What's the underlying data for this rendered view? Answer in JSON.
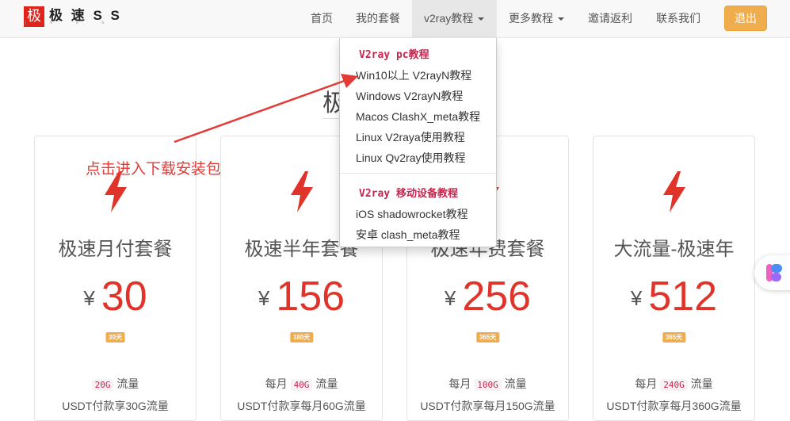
{
  "brand": {
    "logo_char": "极",
    "name": "极 速 S S",
    "subtitle": "j s s s"
  },
  "nav": {
    "items": [
      {
        "label": "首页"
      },
      {
        "label": "我的套餐"
      },
      {
        "label": "v2ray教程"
      },
      {
        "label": "更多教程"
      },
      {
        "label": "邀请返利"
      },
      {
        "label": "联系我们"
      }
    ],
    "logout": "退出"
  },
  "page": {
    "title": "极"
  },
  "dropdown": {
    "pc_header": "V2ray pc教程",
    "pc_items": [
      "Win10以上 V2rayN教程",
      "Windows V2rayN教程",
      "Macos ClashX_meta教程",
      "Linux V2raya使用教程",
      "Linux Qv2ray使用教程"
    ],
    "mobile_header": "V2ray 移动设备教程",
    "mobile_items": [
      "iOS shadowrocket教程",
      "安卓 clash_meta教程"
    ]
  },
  "annotation": "点击进入下载安装包",
  "plans": [
    {
      "name": "极速月付套餐",
      "currency": "¥",
      "price": "30",
      "days": "30天",
      "flow_prefix": "",
      "flow_amount": "20G",
      "flow_suffix": "流量",
      "usdt": "USDT付款享30G流量"
    },
    {
      "name": "极速半年套餐",
      "currency": "¥",
      "price": "156",
      "days": "180天",
      "flow_prefix": "每月",
      "flow_amount": "40G",
      "flow_suffix": "流量",
      "usdt": "USDT付款享每月60G流量"
    },
    {
      "name": "极速年费套餐",
      "currency": "¥",
      "price": "256",
      "days": "365天",
      "flow_prefix": "每月",
      "flow_amount": "100G",
      "flow_suffix": "流量",
      "usdt": "USDT付款享每月150G流量"
    },
    {
      "name": "大流量-极速年",
      "currency": "¥",
      "price": "512",
      "days": "365天",
      "flow_prefix": "每月",
      "flow_amount": "240G",
      "flow_suffix": "流量",
      "usdt": "USDT付款享每月360G流量"
    }
  ],
  "colors": {
    "accent_red": "#e0342b",
    "warning": "#f0ad4e",
    "code_red": "#c7254e",
    "annotation_red": "#e53935"
  },
  "icons": {
    "plan_icon": "lightning-bolt-icon",
    "caret": "caret-down-icon",
    "float": "floating-app-icon"
  }
}
